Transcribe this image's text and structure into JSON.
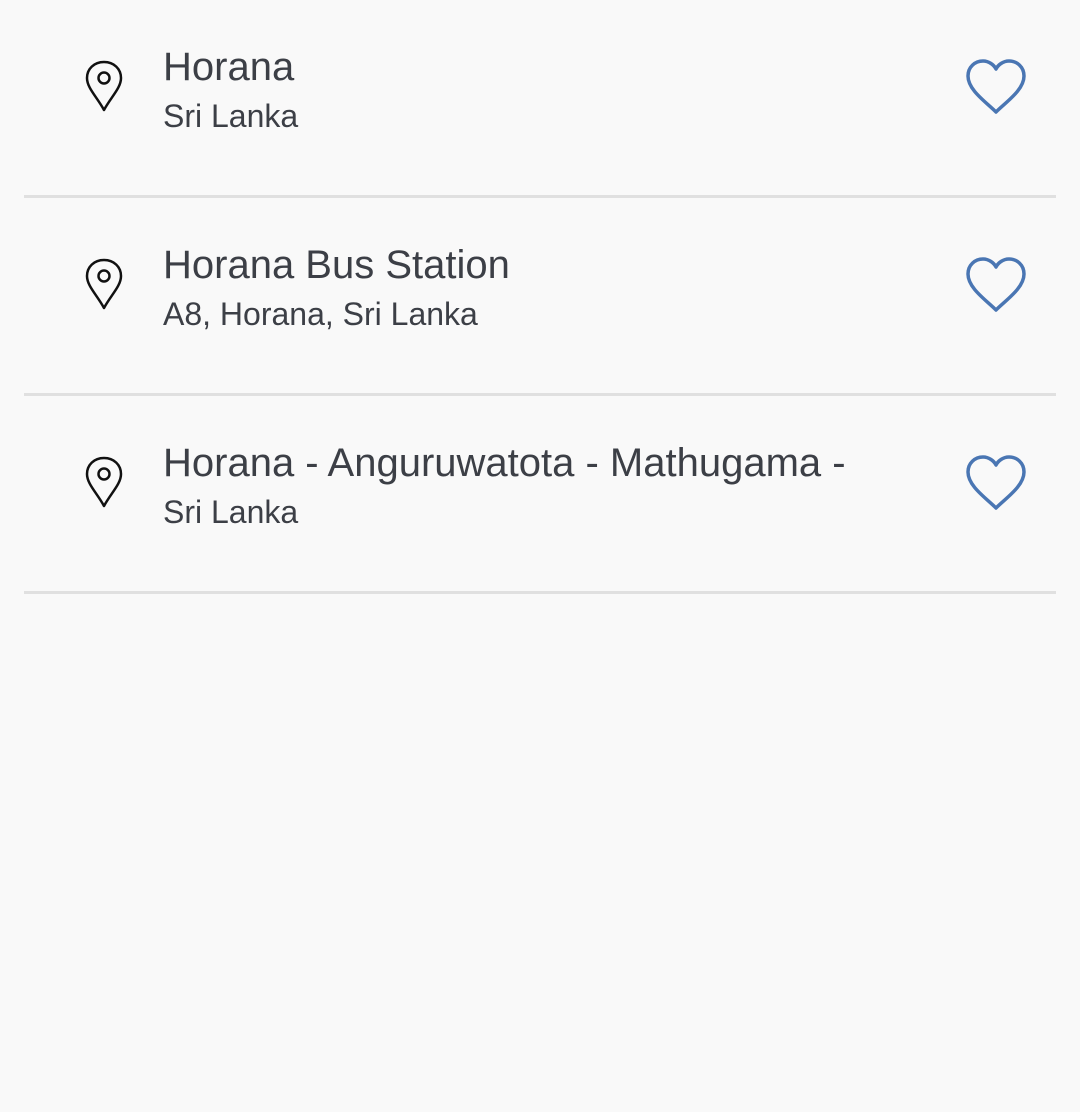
{
  "places": [
    {
      "title": "Horana",
      "subtitle": "Sri Lanka"
    },
    {
      "title": "Horana Bus Station",
      "subtitle": "A8, Horana, Sri Lanka"
    },
    {
      "title": "Horana - Anguruwatota - Mathugama -",
      "subtitle": "Sri Lanka"
    }
  ],
  "icons": {
    "location": "location-pin-icon",
    "favorite": "heart-outline-icon"
  },
  "colors": {
    "background": "#f9f9f9",
    "text": "#3c3f46",
    "heart": "#4a76b3",
    "divider": "#e0e0e0"
  }
}
